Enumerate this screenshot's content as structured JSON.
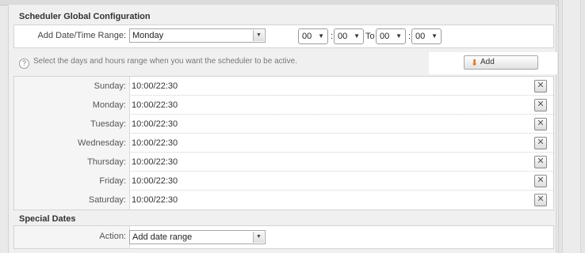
{
  "scheduler": {
    "title": "Scheduler Global Configuration",
    "add_range_label": "Add Date/Time Range:",
    "day_select": "Monday",
    "from_hour": "00",
    "from_minute": "00",
    "to_label": "To",
    "to_hour": "00",
    "to_minute": "00",
    "colon": ":",
    "hint": "Select the days and hours range when you want the scheduler to be active.",
    "add_button": "Add",
    "days": [
      {
        "label": "Sunday:",
        "value": "10:00/22:30"
      },
      {
        "label": "Monday:",
        "value": "10:00/22:30"
      },
      {
        "label": "Tuesday:",
        "value": "10:00/22:30"
      },
      {
        "label": "Wednesday:",
        "value": "10:00/22:30"
      },
      {
        "label": "Thursday:",
        "value": "10:00/22:30"
      },
      {
        "label": "Friday:",
        "value": "10:00/22:30"
      },
      {
        "label": "Saturday:",
        "value": "10:00/22:30"
      }
    ]
  },
  "special": {
    "title": "Special Dates",
    "action_label": "Action:",
    "action_select": "Add date range"
  },
  "icons": {
    "delete": "close-x-icon",
    "add": "add-arrow-icon",
    "help": "question-icon"
  }
}
